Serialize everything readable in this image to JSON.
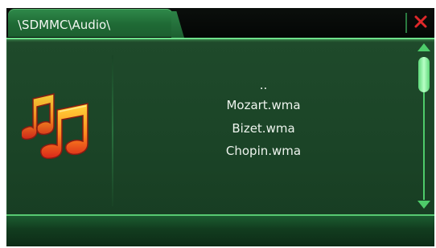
{
  "header": {
    "path": "\\SDMMC\\Audio\\",
    "close_icon": "close-icon",
    "close_color": "#e0282a"
  },
  "sidebar": {
    "icon": "music-notes-icon"
  },
  "files": [
    {
      "name": ".."
    },
    {
      "name": "Mozart.wma"
    },
    {
      "name": "Bizet.wma"
    },
    {
      "name": "Chopin.wma"
    }
  ],
  "scrollbar": {
    "up_icon": "scroll-up-arrow-icon",
    "down_icon": "scroll-down-arrow-icon",
    "position_fraction": 0.0
  },
  "colors": {
    "accent_green": "#4ecb6a",
    "panel_green": "#1d4729"
  }
}
